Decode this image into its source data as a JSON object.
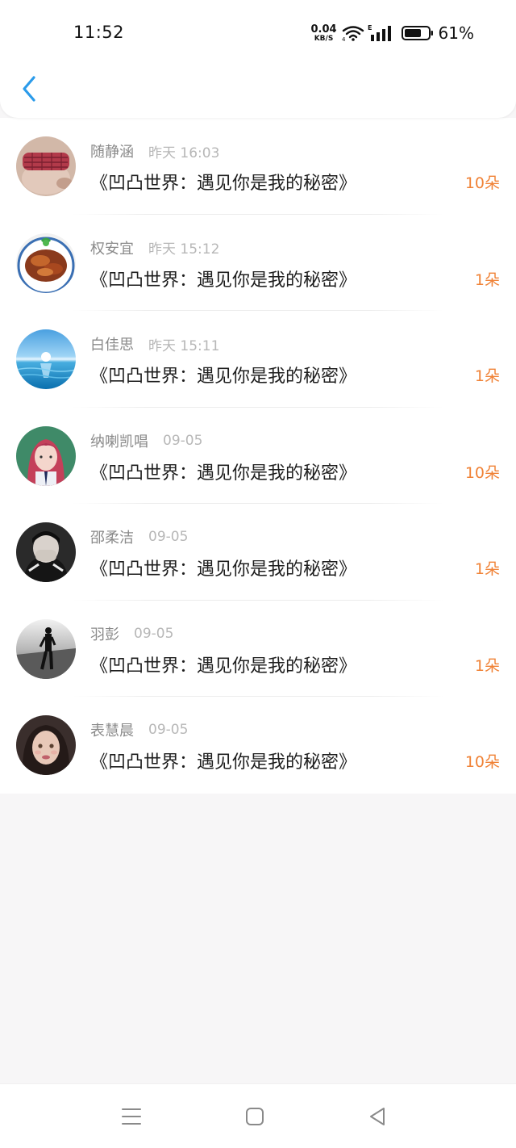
{
  "status_bar": {
    "time": "11:52",
    "net_speed_value": "0.04",
    "net_speed_unit": "KB/S",
    "battery_percent": "61%",
    "icons": [
      "wifi-icon",
      "signal-icon",
      "battery-icon"
    ]
  },
  "header": {
    "back_icon": "chevron-left-icon",
    "accent_color": "#2b9bea"
  },
  "colors": {
    "count_orange": "#f08236",
    "name_gray": "#8a8a8a",
    "time_gray": "#b7b7b7"
  },
  "gift_list": [
    {
      "name": "随静涵",
      "time": "昨天 16:03",
      "title": "《凹凸世界：遇见你是我的秘密》",
      "count": "10朵",
      "avatar": "avatar-eye-mask"
    },
    {
      "name": "权安宜",
      "time": "昨天 15:12",
      "title": "《凹凸世界：遇见你是我的秘密》",
      "count": "1朵",
      "avatar": "avatar-food-bowl"
    },
    {
      "name": "白佳思",
      "time": "昨天 15:11",
      "title": "《凹凸世界：遇见你是我的秘密》",
      "count": "1朵",
      "avatar": "avatar-ocean-sun"
    },
    {
      "name": "纳喇凯唱",
      "time": "09-05",
      "title": "《凹凸世界：遇见你是我的秘密》",
      "count": "10朵",
      "avatar": "avatar-pink-hair-girl"
    },
    {
      "name": "邵柔洁",
      "time": "09-05",
      "title": "《凹凸世界：遇见你是我的秘密》",
      "count": "1朵",
      "avatar": "avatar-masked-person"
    },
    {
      "name": "羽彭",
      "time": "09-05",
      "title": "《凹凸世界：遇见你是我的秘密》",
      "count": "1朵",
      "avatar": "avatar-standing-figure"
    },
    {
      "name": "表慧晨",
      "time": "09-05",
      "title": "《凹凸世界：遇见你是我的秘密》",
      "count": "10朵",
      "avatar": "avatar-girl-portrait"
    }
  ],
  "nav_bar": {
    "icons": [
      "menu-icon",
      "home-square-icon",
      "back-triangle-icon"
    ]
  }
}
